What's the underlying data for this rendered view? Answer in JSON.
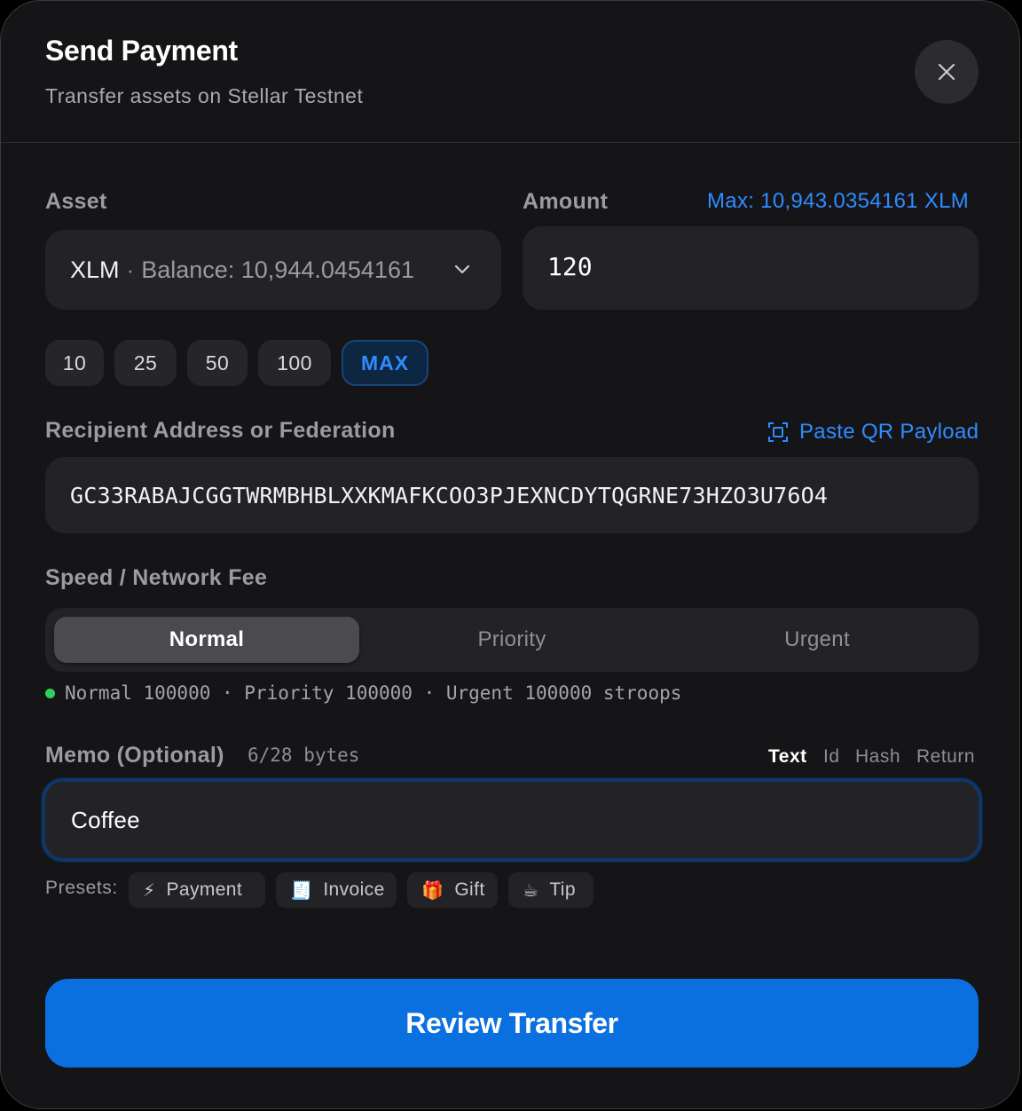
{
  "header": {
    "title": "Send Payment",
    "subtitle": "Transfer assets on Stellar Testnet"
  },
  "asset": {
    "label": "Asset",
    "code": "XLM",
    "separator": "·",
    "balance": "Balance: 10,944.0454161"
  },
  "amount": {
    "label": "Amount",
    "max_link": "Max: 10,943.0354161 XLM",
    "value": "120"
  },
  "quick_amounts": [
    "10",
    "25",
    "50",
    "100",
    "MAX"
  ],
  "recipient": {
    "label": "Recipient Address or Federation",
    "paste_link": "Paste QR Payload",
    "value": "GC33RABAJCGGTWRMBHBLXXKMAFKCOO3PJEXNCDYTQGRNE73HZO3U76O4"
  },
  "fee": {
    "label": "Speed / Network Fee",
    "options": [
      "Normal",
      "Priority",
      "Urgent"
    ],
    "selected": "Normal",
    "summary": "Normal 100000 · Priority 100000 · Urgent 100000 stroops"
  },
  "memo": {
    "label": "Memo (Optional)",
    "bytes": "6/28 bytes",
    "types": [
      "Text",
      "Id",
      "Hash",
      "Return"
    ],
    "selected_type": "Text",
    "value": "Coffee",
    "presets_label": "Presets:",
    "presets": [
      {
        "icon": "⚡",
        "label": "Payment"
      },
      {
        "icon": "🧾",
        "label": "Invoice"
      },
      {
        "icon": "🎁",
        "label": "Gift"
      },
      {
        "icon": "☕",
        "label": "Tip"
      }
    ]
  },
  "cta": {
    "label": "Review Transfer"
  },
  "colors": {
    "accent": "#0a70e0",
    "link": "#2f8cff",
    "success": "#2fcf5a"
  }
}
